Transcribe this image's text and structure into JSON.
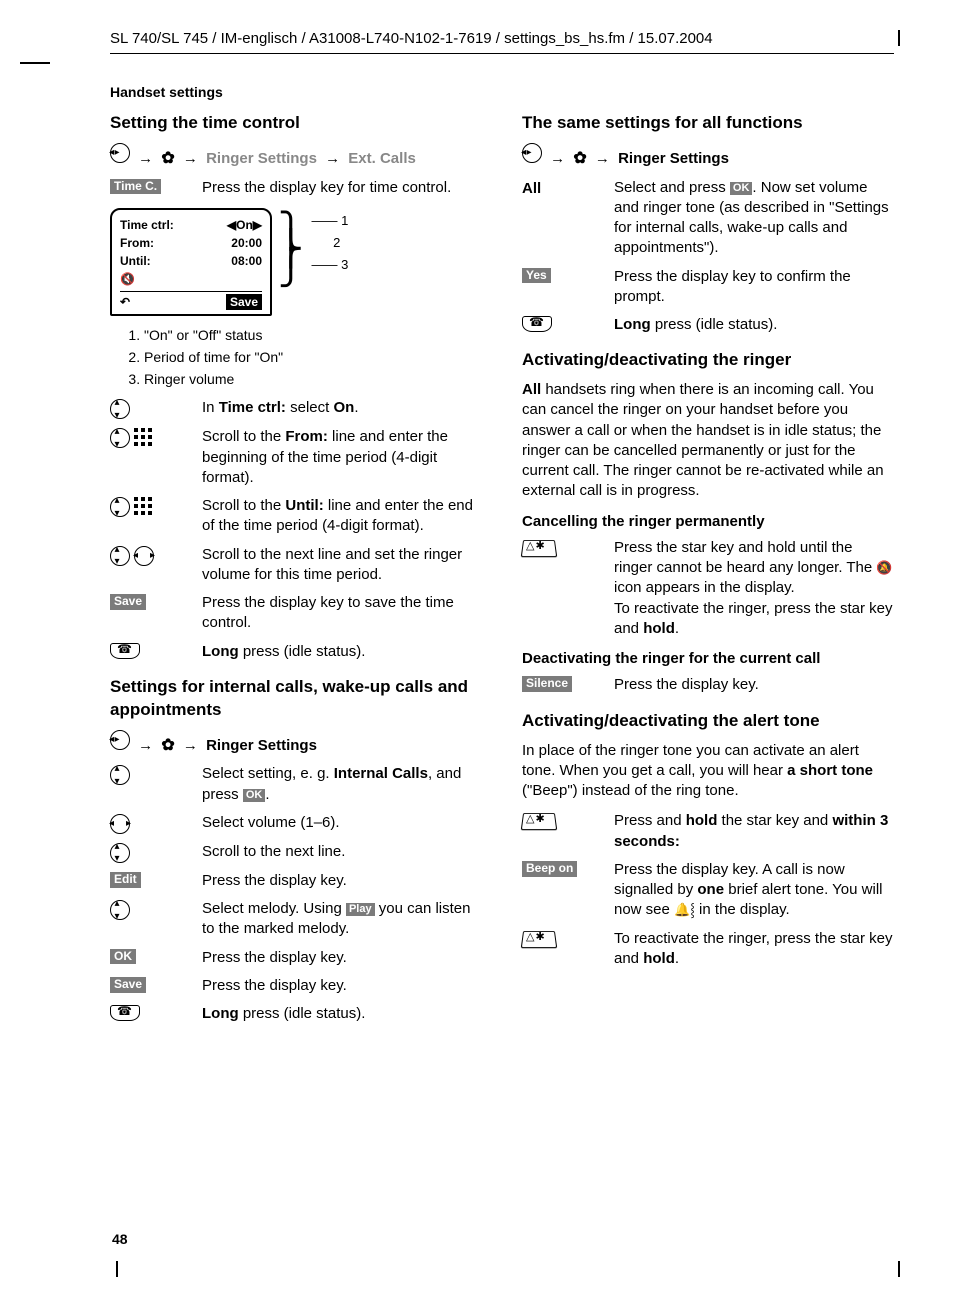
{
  "header": {
    "path": "SL 740/SL 745 / IM-englisch / A31008-L740-N102-1-7619 / settings_bs_hs.fm / 15.07.2004"
  },
  "section_label": "Handset settings",
  "page_number": "48",
  "nav": {
    "ringer_settings": "Ringer Settings",
    "ext_calls": "Ext. Calls",
    "arrow": "→"
  },
  "left": {
    "h_time_ctrl": "Setting the time control",
    "time_c_key": "Time C.",
    "time_c_text": "Press the display key for time control.",
    "phone": {
      "row1_label": "Time ctrl:",
      "row1_value": "◀On▶",
      "row2_label": "From:",
      "row2_value": "20:00",
      "row3_label": "Until:",
      "row3_value": "08:00",
      "bottom_left": "↶",
      "bottom_right": "Save",
      "call1": "1",
      "call2": "2",
      "call3": "3"
    },
    "legend": {
      "i1": "\"On\" or \"Off\" status",
      "i2": "Period of time for \"On\"",
      "i3": "Ringer volume"
    },
    "steps_a": {
      "s1_pre": "In ",
      "s1_b": "Time ctrl:",
      "s1_mid": " select ",
      "s1_on": "On",
      "s1_end": ".",
      "s2_pre": "Scroll to the ",
      "s2_b": "From:",
      "s2_rest": " line and enter the beginning of the time period (4-digit format).",
      "s3_pre": "Scroll to the ",
      "s3_b": "Until:",
      "s3_rest": " line and enter the end of the time period (4-digit format).",
      "s4": "Scroll to the next line and set the ringer volume for this time period.",
      "save_key": "Save",
      "save_text": "Press the display key to save the time control.",
      "long_b": "Long",
      "long_rest": " press (idle status)."
    },
    "h_internal": "Settings for internal calls, wake-up calls and appointments",
    "steps_b": {
      "s1_pre": "Select setting, e. g. ",
      "s1_b": "Internal Calls",
      "s1_mid": ", and press ",
      "s1_end": ".",
      "s2": "Select volume (1–6).",
      "s3": "Scroll to the next line.",
      "edit_key": "Edit",
      "edit_text": "Press the display key.",
      "s5_pre": "Select melody. Using ",
      "s5_mid": " you can listen to the marked melody.",
      "play_key": "Play",
      "ok_key": "OK",
      "ok_text": "Press the display key.",
      "save_key": "Save",
      "save_text": "Press the display key.",
      "long_b": "Long",
      "long_rest": " press (idle status)."
    }
  },
  "right": {
    "h_all": "The same settings for all functions",
    "all_key": "All",
    "all_text_pre": "Select and press ",
    "all_text_rest": ". Now set volume and ringer tone (as described in \"Settings for internal calls, wake-up calls and appointments\").",
    "yes_key": "Yes",
    "yes_text": "Press the display key to confirm the prompt.",
    "long_b": "Long",
    "long_rest": " press (idle status).",
    "h_ringer": "Activating/deactivating the ringer",
    "ringer_para_pre": "All",
    "ringer_para_rest": " handsets ring when there is an incoming call. You can cancel the ringer on your handset before you answer a call or when the handset is in idle status; the ringer can be cancelled permanently or just for the current call. The ringer cannot be re-activated while an external call is in progress.",
    "h_cancel": "Cancelling the ringer permanently",
    "cancel_text_1": "Press the star key and hold until the ringer cannot be heard any longer. The ",
    "cancel_text_2": " icon appears in the display.",
    "cancel_text_3": "To reactivate the ringer, press the star key and ",
    "cancel_hold": "hold",
    "h_deact_cur": "Deactivating the ringer for the current call",
    "silence_key": "Silence",
    "silence_text": "Press the display key.",
    "h_alert": "Activating/deactivating the alert tone",
    "alert_para_1": "In place of the ringer tone you can activate an alert tone. When you get a call, you will hear ",
    "alert_para_b": "a short tone",
    "alert_para_2": " (\"Beep\") instead of the ring tone.",
    "alert_s1_pre": "Press and ",
    "alert_s1_hold": "hold",
    "alert_s1_mid": " the star key and ",
    "alert_s1_b2": "within 3 seconds:",
    "beep_key": "Beep on",
    "beep_text_1": "Press the display key. A call is now signalled by ",
    "beep_text_b": "one",
    "beep_text_2": " brief alert tone. You will now see ",
    "beep_text_3": " in the display.",
    "alert_s3_pre": "To reactivate the ringer, press the star key and ",
    "alert_s3_hold": "hold",
    "alert_s3_end": "."
  },
  "ok_chip": "OK"
}
